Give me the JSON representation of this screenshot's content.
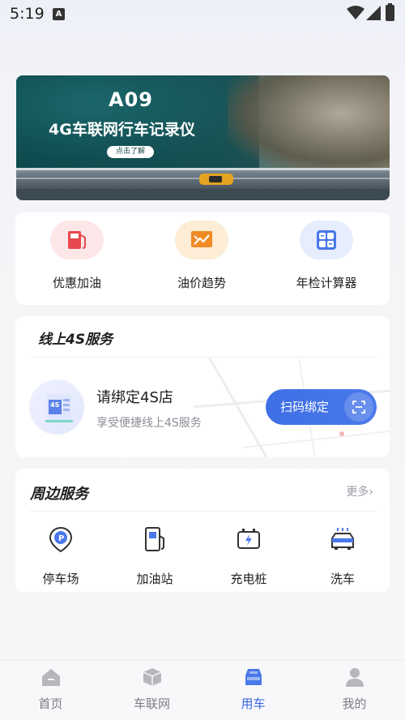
{
  "status_bar": {
    "time": "5:19",
    "a_icon_text": "A"
  },
  "banner": {
    "title": "A09",
    "subtitle": "4G车联网行车记录仪",
    "cta": "点击了解"
  },
  "tools": [
    {
      "label": "优惠加油",
      "icon": "fuel-pump-icon"
    },
    {
      "label": "油价趋势",
      "icon": "price-trend-icon"
    },
    {
      "label": "年检计算器",
      "icon": "calculator-icon"
    }
  ],
  "online_4s": {
    "title": "线上4S服务",
    "shop_name": "请绑定4S店",
    "description": "享受便捷线上4S服务",
    "button_label": "扫码绑定",
    "shop_badge": "4S"
  },
  "nearby": {
    "title": "周边服务",
    "more": "更多",
    "items": [
      {
        "label": "停车场",
        "icon": "parking-icon"
      },
      {
        "label": "加油站",
        "icon": "gas-station-icon"
      },
      {
        "label": "充电桩",
        "icon": "charging-pile-icon"
      },
      {
        "label": "洗车",
        "icon": "car-wash-icon"
      }
    ]
  },
  "tabs": [
    {
      "label": "首页",
      "icon": "home-icon"
    },
    {
      "label": "车联网",
      "icon": "iov-icon"
    },
    {
      "label": "用车",
      "icon": "car-use-icon",
      "active": true
    },
    {
      "label": "我的",
      "icon": "profile-icon"
    }
  ],
  "colors": {
    "accent": "#3a66e0",
    "fuel_red": "#e8484f",
    "trend_orange": "#f08a24",
    "calc_blue": "#4a78e8"
  }
}
